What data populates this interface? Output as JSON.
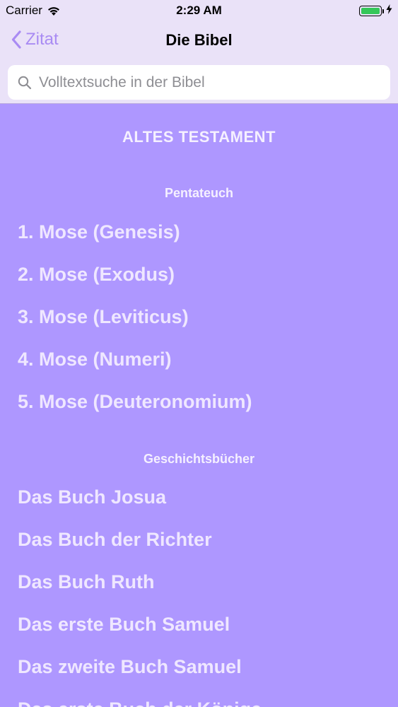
{
  "status_bar": {
    "carrier": "Carrier",
    "time": "2:29 AM",
    "battery_color": "#35C759"
  },
  "nav": {
    "back_label": "Zitat",
    "back_icon": "chevron-left-icon",
    "title": "Die Bibel",
    "tint_color": "#A98BF3"
  },
  "search": {
    "placeholder": "Volltextsuche in der Bibel",
    "value": ""
  },
  "colors": {
    "background": "#AE97FF",
    "header_background": "#EAE2F8",
    "text": "#F5F0FF"
  },
  "section": {
    "title": "ALTES TESTAMENT"
  },
  "groups": [
    {
      "header": "Pentateuch",
      "books": [
        "1. Mose (Genesis)",
        "2. Mose (Exodus)",
        "3. Mose (Leviticus)",
        "4. Mose (Numeri)",
        "5. Mose (Deuteronomium)"
      ]
    },
    {
      "header": "Geschichtsbücher",
      "books": [
        "Das Buch Josua",
        "Das Buch der Richter",
        "Das Buch Ruth",
        "Das erste Buch Samuel",
        "Das zweite Buch Samuel",
        "Das erste Buch der Könige"
      ]
    }
  ]
}
